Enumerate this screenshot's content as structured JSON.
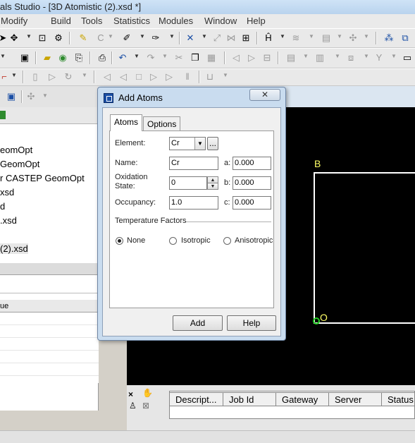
{
  "window": {
    "title": "als Studio - [3D Atomistic (2).xsd *]"
  },
  "menu": [
    "Modify",
    "Build",
    "Tools",
    "Statistics",
    "Modules",
    "Window",
    "Help"
  ],
  "project_tree": {
    "items": [
      "eomOpt",
      "GeomOpt",
      "r CASTEP GeomOpt",
      "xsd",
      "d",
      ".xsd",
      "(2).xsd"
    ]
  },
  "properties": {
    "column_header": "ue"
  },
  "document": {
    "label_b": "B",
    "label_o": "O"
  },
  "job_panel": {
    "columns": [
      "Descript...",
      "Job Id",
      "Gateway",
      "Server",
      "Status"
    ]
  },
  "dialog": {
    "title": "Add Atoms",
    "close_glyph": "✕",
    "tabs": [
      "Atoms",
      "Options"
    ],
    "element_label": "Element:",
    "element_value": "Cr",
    "browse_label": "...",
    "name_label": "Name:",
    "name_value": "Cr",
    "oxidation_label_1": "Oxidation",
    "oxidation_label_2": "State:",
    "oxidation_value": "0",
    "occupancy_label": "Occupancy:",
    "occupancy_value": "1.0",
    "a_label": "a:",
    "a_value": "0.000",
    "b_label": "b:",
    "b_value": "0.000",
    "c_label": "c:",
    "c_value": "0.000",
    "temperature_heading": "Temperature Factors",
    "radio_none": "None",
    "radio_isotropic": "Isotropic",
    "radio_anisotropic": "Anisotropic",
    "selected_radio": "None",
    "add_button": "Add",
    "help_button": "Help"
  },
  "colors": {
    "document_bg": "#000000",
    "cell_line": "#ffffff",
    "label_b": "#ffff66",
    "origin_marker": "#22cc22"
  }
}
